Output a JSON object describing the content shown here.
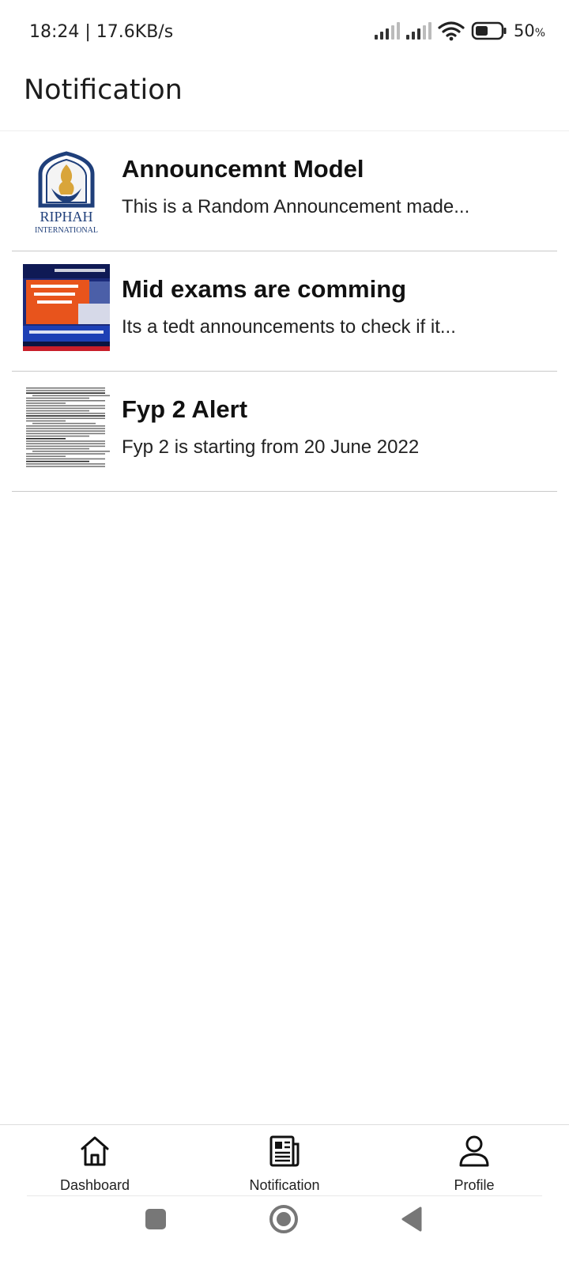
{
  "status_bar": {
    "time": "18:24 | 17.6KB/s",
    "battery_percent": "50",
    "battery_unit": "%",
    "battery_level": 0.5
  },
  "header": {
    "title": "Notification"
  },
  "notifications": [
    {
      "title": "Announcemnt Model",
      "body": "This is a Random Announcement made...",
      "thumb_icon": "riphah-logo",
      "thumb_text_1": "RIPHAH",
      "thumb_text_2": "INTERNATIONAL"
    },
    {
      "title": "Mid exams are comming",
      "body": "Its a tedt announcements to check if it...",
      "thumb_icon": "news-screenshot"
    },
    {
      "title": "Fyp 2 Alert",
      "body": "Fyp 2 is starting from 20 June 2022",
      "thumb_icon": "document-page"
    }
  ],
  "bottom_nav": {
    "items": [
      {
        "label": "Dashboard",
        "icon": "home-icon"
      },
      {
        "label": "Notification",
        "icon": "newspaper-icon"
      },
      {
        "label": "Profile",
        "icon": "person-icon"
      }
    ]
  },
  "system_nav": {
    "buttons": [
      "recents-icon",
      "home-circle-icon",
      "back-icon"
    ]
  },
  "colors": {
    "accent_orange": "#e8541c",
    "news_blue": "#1b2a7a",
    "riphah_blue": "#1f3f7a",
    "riphah_gold": "#d9a53a"
  }
}
